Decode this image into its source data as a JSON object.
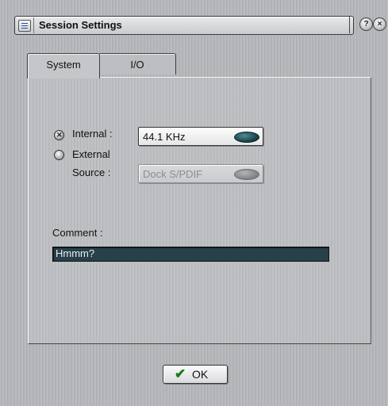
{
  "window": {
    "title": "Session Settings",
    "help_icon": "question-icon",
    "close_icon": "close-icon",
    "help_glyph": "?",
    "close_glyph": "×"
  },
  "tabs": [
    {
      "label": "System",
      "selected": true
    },
    {
      "label": "I/O",
      "selected": false
    }
  ],
  "clock": {
    "internal": {
      "label": "Internal :",
      "selected": true,
      "value": "44.1 KHz"
    },
    "external": {
      "label_line1": "External",
      "label_line2": "Source :",
      "selected": false,
      "value": "Dock S/PDIF",
      "enabled": false
    }
  },
  "comment": {
    "label": "Comment :",
    "value": "Hmmm?"
  },
  "buttons": {
    "ok_label": "OK",
    "ok_icon": "checkmark-icon"
  },
  "colors": {
    "comment_bg": "#27404a",
    "knob": "#163b42",
    "check": "#1e7a1e"
  }
}
